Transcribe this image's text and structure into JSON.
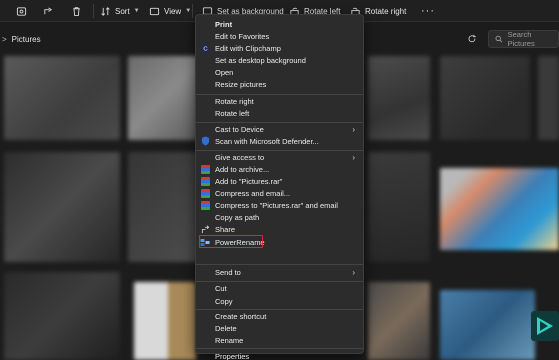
{
  "toolbar": {
    "sort_label": "Sort",
    "view_label": "View",
    "set_bg_label": "Set as background",
    "rotate_left_label": "Rotate left",
    "rotate_right_label": "Rotate right",
    "icons": [
      "share-icon",
      "delete-icon",
      "sort-icon",
      "view-icon",
      "more-icon"
    ]
  },
  "address": {
    "path_separator": ">",
    "folder": "Pictures"
  },
  "search": {
    "placeholder": "Search Pictures"
  },
  "menu": {
    "items": [
      {
        "label": "Print",
        "bold": true
      },
      {
        "label": "Edit to Favorites"
      },
      {
        "label": "Edit with Clipchamp",
        "icon": "clipchamp-icon"
      },
      {
        "label": "Set as desktop background"
      },
      {
        "label": "Open"
      },
      {
        "label": "Resize pictures"
      },
      {
        "label": "Rotate right"
      },
      {
        "label": "Rotate left"
      },
      {
        "label": "Cast to Device",
        "submenu": true
      },
      {
        "label": "Scan with Microsoft Defender...",
        "icon": "defender-shield-icon"
      },
      {
        "label": "Give access to",
        "submenu": true
      },
      {
        "label": "Add to archive...",
        "icon": "winrar-icon"
      },
      {
        "label": "Add to \"Pictures.rar\"",
        "icon": "winrar-icon"
      },
      {
        "label": "Compress and email...",
        "icon": "winrar-icon"
      },
      {
        "label": "Compress to \"Pictures.rar\" and email",
        "icon": "winrar-icon"
      },
      {
        "label": "Copy as path"
      },
      {
        "label": "Share",
        "icon": "share-icon"
      },
      {
        "label": "PowerRename",
        "icon": "powerrename-icon",
        "highlighted": true
      },
      {
        "label": "Send to",
        "submenu": true
      },
      {
        "label": "Cut"
      },
      {
        "label": "Copy"
      },
      {
        "label": "Create shortcut"
      },
      {
        "label": "Delete"
      },
      {
        "label": "Rename"
      },
      {
        "label": "Properties"
      }
    ],
    "submenu_arrow": "›"
  },
  "colors": {
    "highlight_border": "#e0262e",
    "menu_bg": "#2c2c2c",
    "window_bg": "#1c1c1c"
  }
}
